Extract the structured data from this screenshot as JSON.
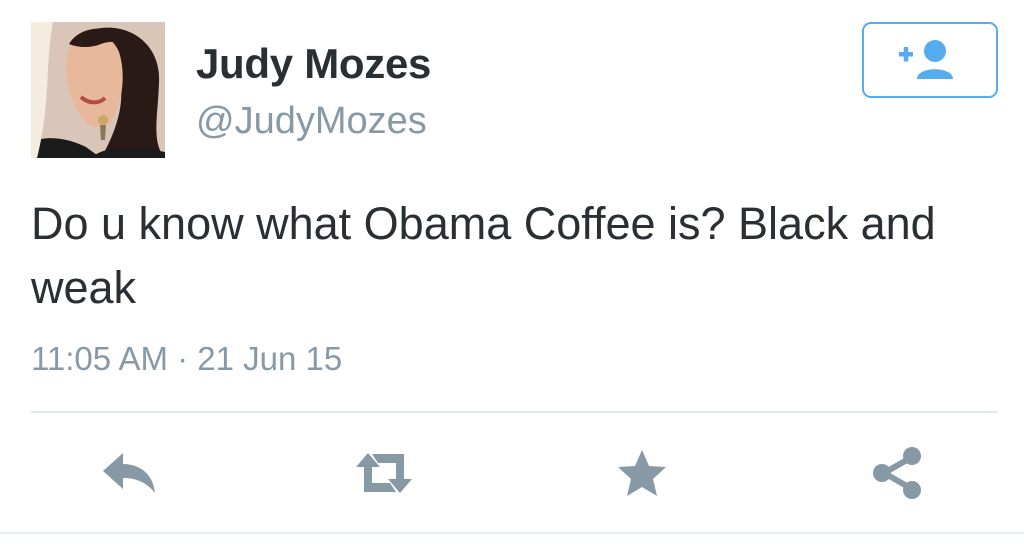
{
  "author": {
    "display_name": "Judy Mozes",
    "handle": "@JudyMozes",
    "avatar_icon": "profile-photo"
  },
  "follow": {
    "icon": "follow-user-icon",
    "accent_color": "#55acee"
  },
  "tweet": {
    "text": "Do u know what Obama Coffee is? Black and weak",
    "timestamp": "11:05 AM · 21 Jun 15"
  },
  "actions": [
    {
      "icon": "reply-icon"
    },
    {
      "icon": "retweet-icon"
    },
    {
      "icon": "star-icon"
    },
    {
      "icon": "share-icon"
    }
  ],
  "colors": {
    "text": "#292f33",
    "secondary": "#8899a6",
    "action_icon": "#8899a6",
    "divider": "#e1e8ed"
  }
}
